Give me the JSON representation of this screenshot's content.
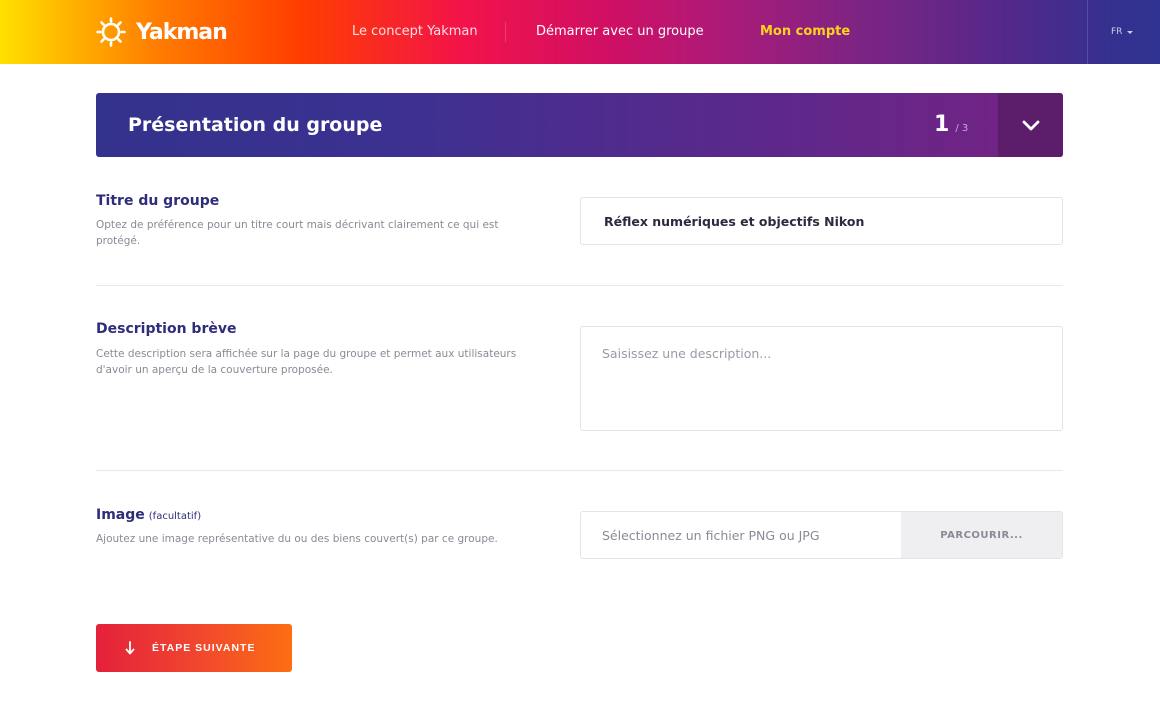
{
  "header": {
    "logo_text": "Yakman",
    "nav": {
      "concept": "Le concept Yakman",
      "start": "Démarrer avec un groupe",
      "account": "Mon compte"
    },
    "language": "FR"
  },
  "step": {
    "title": "Présentation du groupe",
    "current": "1",
    "total": "/ 3"
  },
  "form": {
    "title_field": {
      "label": "Titre du groupe",
      "help": "Optez de préférence pour un titre court mais décrivant clairement ce qui est protégé.",
      "value": "Réflex numériques et objectifs Nikon"
    },
    "description_field": {
      "label": "Description brève",
      "help": "Cette description sera affichée sur la page du groupe et permet aux utilisateurs d'avoir un aperçu de la couverture proposée.",
      "placeholder": "Saisissez une description..."
    },
    "image_field": {
      "label": "Image",
      "optional": "(facultatif)",
      "help": "Ajoutez une image représentative du ou des biens couvert(s) par ce groupe.",
      "placeholder": "Sélectionnez un fichier PNG ou JPG",
      "browse_label": "PARCOURIR..."
    }
  },
  "actions": {
    "next_label": "ÉTAPE SUIVANTE"
  },
  "icons": {
    "logo": "sun-logo-icon",
    "toggle": "chevron-down-icon",
    "next": "arrow-down-icon",
    "lang_caret": "caret-down-icon"
  },
  "colors": {
    "accent_yellow": "#ffd21f",
    "banner_start": "#33328c",
    "banner_end": "#752283",
    "label_navy": "#2e2d7a",
    "cta_start": "#e4213a",
    "cta_end": "#fd6e12"
  }
}
